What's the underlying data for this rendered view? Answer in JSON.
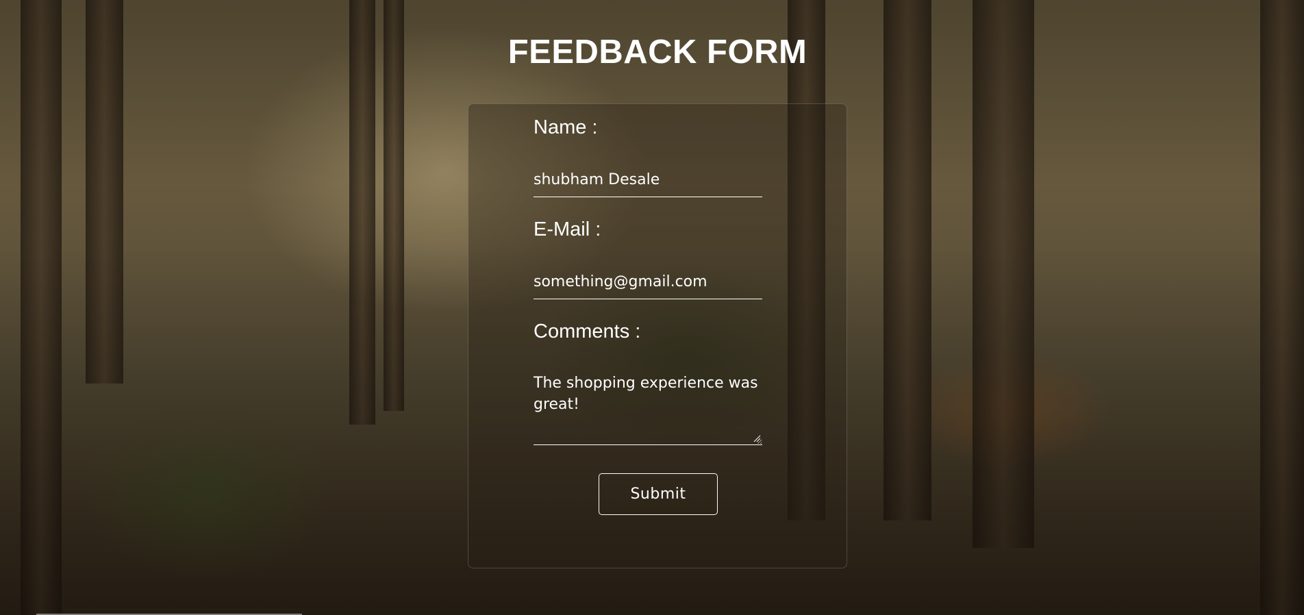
{
  "page": {
    "title": "FEEDBACK FORM"
  },
  "form": {
    "name_label": "Name :",
    "name_value": "shubham Desale",
    "email_label": "E-Mail :",
    "email_value": "something@gmail.com",
    "comments_label": "Comments :",
    "comments_value": "The shopping experience was great!",
    "submit_label": "Submit"
  },
  "theme": {
    "text_color": "#ffffff",
    "card_background": "rgba(40,32,22,0.38)"
  }
}
